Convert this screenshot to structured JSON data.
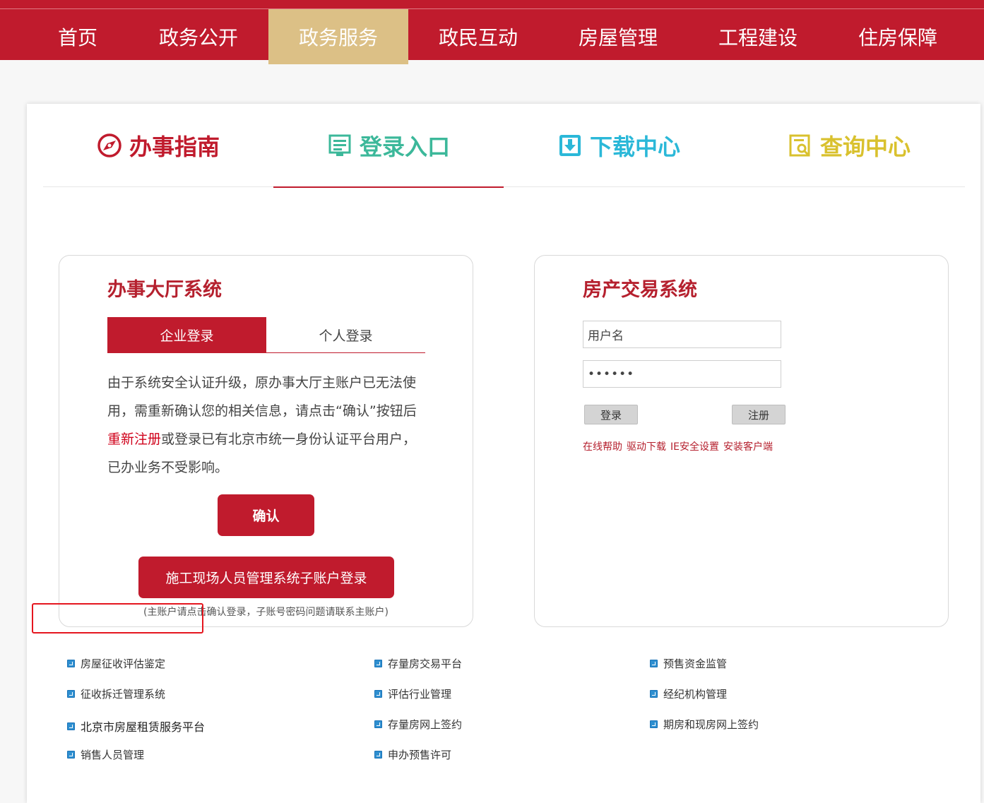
{
  "nav": {
    "items": [
      "首页",
      "政务公开",
      "政务服务",
      "政民互动",
      "房屋管理",
      "工程建设",
      "住房保障"
    ],
    "active": "政务服务"
  },
  "tabs": [
    {
      "label": "办事指南",
      "icon": "compass-icon",
      "color": "#c01b2d"
    },
    {
      "label": "登录入口",
      "icon": "login-form-icon",
      "color": "#3cb89a"
    },
    {
      "label": "下载中心",
      "icon": "download-icon",
      "color": "#2bb8d8"
    },
    {
      "label": "查询中心",
      "icon": "search-document-icon",
      "color": "#d9c12e"
    }
  ],
  "hall": {
    "title": "办事大厅系统",
    "tab_company": "企业登录",
    "tab_personal": "个人登录",
    "desc_part1": "由于系统安全认证升级，原办事大厅主账户已无法使用，需重新确认您的相关信息，请点击“确认”按钮后",
    "desc_link": "重新注册",
    "desc_part2": "或登录已有北京市统一身份认证平台用户，已办业务不受影响。",
    "confirm_label": "确认",
    "sub_login_label": "施工现场人员管理系统子账户登录",
    "note": "(主账户请点击确认登录，子账号密码问题请联系主账户)"
  },
  "trade": {
    "title": "房产交易系统",
    "username_value": "用户名",
    "password_value": "••••••",
    "login_label": "登录",
    "register_label": "注册",
    "help_links": [
      "在线帮助",
      "驱动下载",
      "IE安全设置",
      "安装客户端"
    ]
  },
  "links": {
    "col1": [
      "房屋征收评估鉴定",
      "征收拆迁管理系统",
      "北京市房屋租赁服务平台",
      "销售人员管理"
    ],
    "col2": [
      "存量房交易平台",
      "评估行业管理",
      "存量房网上签约",
      "申办预售许可"
    ],
    "col3": [
      "预售资金监管",
      "经纪机构管理",
      "期房和现房网上签约"
    ]
  },
  "colors": {
    "primary_red": "#c01b2d",
    "active_nav": "#dcc086",
    "highlight_border": "#e5161f"
  }
}
